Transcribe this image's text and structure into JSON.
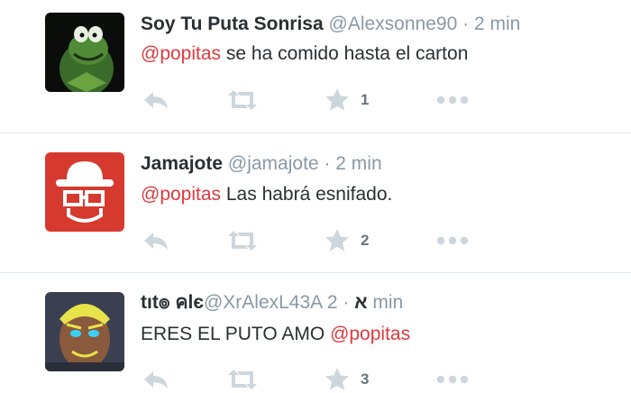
{
  "tweets": [
    {
      "fullname": "Soy Tu Puta Sonrisa",
      "username": "@Alexsonne90",
      "separator": "·",
      "time": "2 min",
      "mention": "@popitas",
      "text": " se ha comido hasta el carton",
      "favorite_count": "1",
      "avatar_icon": "kermit-frog-avatar"
    },
    {
      "fullname": "Jamajote",
      "username": "@jamajote",
      "separator": "·",
      "time": "2 min",
      "mention": "@popitas",
      "text": " Las habrá esnifado.",
      "favorite_count": "2",
      "avatar_icon": "bowler-hat-glasses-avatar"
    },
    {
      "fullname": "tıt๏ คlє",
      "username": "@XrAlexL43A",
      "fullname_suffix": "א",
      "separator": "·",
      "time": "2 min",
      "text": "ERES EL PUTO AMO ",
      "mention": "@popitas",
      "favorite_count": "3",
      "avatar_icon": "yellow-face-avatar"
    }
  ],
  "colors": {
    "mention": "#e0393e",
    "muted": "#8899a6",
    "icon": "#ccd6dd",
    "divider": "#e1e8ed"
  }
}
